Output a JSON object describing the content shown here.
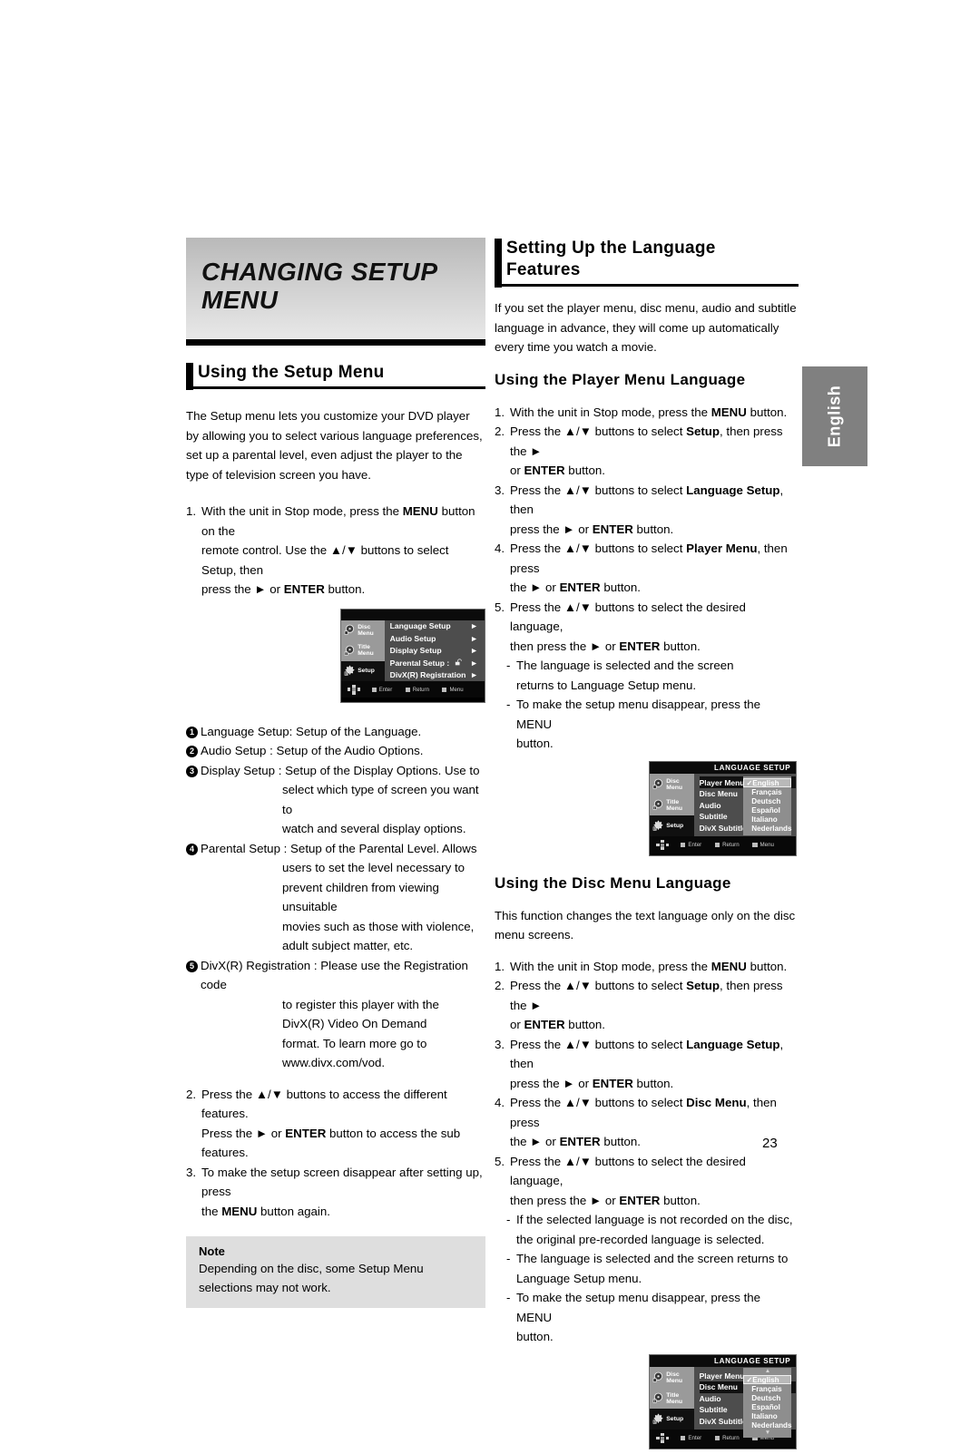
{
  "page": {
    "number": "23",
    "side_tab": "English"
  },
  "left": {
    "chapter_title": "CHANGING SETUP\nMENU",
    "section_heading": "Using the Setup Menu",
    "intro": "The Setup menu lets you customize your DVD player by allowing you to select various language preferences, set up a parental level, even adjust the player to the type of television screen you have.",
    "step1": {
      "num": "1.",
      "line1_a": "With the unit in Stop mode, press the ",
      "line1_b": "MENU",
      "line1_c": " button on the",
      "line2": "remote control.  Use the ▲/▼ buttons to select Setup, then",
      "line3_a": "press the ► or ",
      "line3_b": "ENTER",
      "line3_c": " button."
    },
    "definitions": [
      {
        "mark": "1",
        "term": "Language Setup: Setup of the Language.",
        "cont": []
      },
      {
        "mark": "2",
        "term": "Audio Setup : Setup of the Audio Options.",
        "cont": []
      },
      {
        "mark": "3",
        "term": "Display Setup : Setup of the Display Options. Use to",
        "cont": [
          "select which type of screen you want to",
          "watch and several display options."
        ]
      },
      {
        "mark": "4",
        "term": "Parental Setup : Setup of the Parental Level. Allows",
        "cont": [
          "users to set the level necessary to",
          "prevent children from viewing unsuitable",
          "movies such as those with violence,",
          "adult subject matter, etc."
        ]
      },
      {
        "mark": "5",
        "term": "DivX(R) Registration : Please use the Registration code",
        "cont": [
          "to register this player with the",
          "DivX(R) Video On Demand",
          "format. To learn more go to",
          "www.divx.com/vod."
        ]
      }
    ],
    "step2": {
      "num": "2.",
      "line1": "Press the ▲/▼ buttons to access the different  features.",
      "line2_a": "Press the ► or ",
      "line2_b": "ENTER",
      "line2_c": " button to access the sub features."
    },
    "step3": {
      "num": "3.",
      "line1": "To make the setup screen disappear after setting up, press",
      "line2_a": "the ",
      "line2_b": "MENU",
      "line2_c": " button again."
    },
    "note": {
      "title": "Note",
      "text": "Depending on the disc, some Setup Menu selections may not work."
    }
  },
  "right": {
    "section_heading": "Setting Up the Language\nFeatures",
    "intro": "If you set the player menu, disc menu, audio and subtitle language in advance, they will come up automatically every time you watch a movie.",
    "player_menu": {
      "heading": "Using the Player Menu Language",
      "steps": [
        {
          "num": "1.",
          "parts": [
            {
              "t": "With the unit in Stop mode, press the "
            },
            {
              "t": "MENU",
              "b": true
            },
            {
              "t": " button."
            }
          ]
        },
        {
          "num": "2.",
          "parts": [
            {
              "t": "Press the ▲/▼ buttons to select "
            },
            {
              "t": "Setup",
              "b": true
            },
            {
              "t": ", then press the ►"
            }
          ],
          "cont": [
            [
              {
                "t": "or "
              },
              {
                "t": "ENTER",
                "b": true
              },
              {
                "t": " button."
              }
            ]
          ]
        },
        {
          "num": "3.",
          "parts": [
            {
              "t": "Press the ▲/▼ buttons to select "
            },
            {
              "t": "Language Setup",
              "b": true
            },
            {
              "t": ", then"
            }
          ],
          "cont": [
            [
              {
                "t": "press the ► or "
              },
              {
                "t": "ENTER",
                "b": true
              },
              {
                "t": " button."
              }
            ]
          ]
        },
        {
          "num": "4.",
          "parts": [
            {
              "t": "Press the ▲/▼ buttons to select "
            },
            {
              "t": "Player Menu",
              "b": true
            },
            {
              "t": ", then press"
            }
          ],
          "cont": [
            [
              {
                "t": "the ► or "
              },
              {
                "t": "ENTER",
                "b": true
              },
              {
                "t": " button."
              }
            ]
          ]
        },
        {
          "num": "5.",
          "parts": [
            {
              "t": "Press the ▲/▼ buttons to select the desired language,"
            }
          ],
          "cont": [
            [
              {
                "t": "then press the ► or "
              },
              {
                "t": "ENTER",
                "b": true
              },
              {
                "t": " button."
              }
            ]
          ]
        }
      ],
      "dashes": [
        {
          "l1": "The language is selected and the screen",
          "l2": "returns to Language Setup menu."
        },
        {
          "l1": "To make the setup menu disappear, press the MENU",
          "l2": "button."
        }
      ]
    },
    "disc_menu": {
      "heading": "Using the Disc Menu Language",
      "intro": "This function changes the text language only on the disc menu screens.",
      "steps": [
        {
          "num": "1.",
          "parts": [
            {
              "t": "With the unit in Stop mode, press the "
            },
            {
              "t": "MENU",
              "b": true
            },
            {
              "t": " button."
            }
          ]
        },
        {
          "num": "2.",
          "parts": [
            {
              "t": "Press the ▲/▼ buttons to select "
            },
            {
              "t": "Setup",
              "b": true
            },
            {
              "t": ", then press the ►"
            }
          ],
          "cont": [
            [
              {
                "t": "or "
              },
              {
                "t": "ENTER",
                "b": true
              },
              {
                "t": " button."
              }
            ]
          ]
        },
        {
          "num": "3.",
          "parts": [
            {
              "t": "Press the ▲/▼ buttons to select "
            },
            {
              "t": "Language Setup",
              "b": true
            },
            {
              "t": ", then"
            }
          ],
          "cont": [
            [
              {
                "t": "press the ► or "
              },
              {
                "t": "ENTER",
                "b": true
              },
              {
                "t": " button."
              }
            ]
          ]
        },
        {
          "num": "4.",
          "parts": [
            {
              "t": "Press the  ▲/▼ buttons to select "
            },
            {
              "t": "Disc Menu",
              "b": true
            },
            {
              "t": ", then press"
            }
          ],
          "cont": [
            [
              {
                "t": "the ► or "
              },
              {
                "t": "ENTER",
                "b": true
              },
              {
                "t": "  button."
              }
            ]
          ]
        },
        {
          "num": "5.",
          "parts": [
            {
              "t": "Press the ▲/▼ buttons to select the desired language,"
            }
          ],
          "cont": [
            [
              {
                "t": "then press the ► or "
              },
              {
                "t": "ENTER",
                "b": true
              },
              {
                "t": " button."
              }
            ]
          ]
        }
      ],
      "dashes": [
        {
          "l1": "If the selected language is not recorded on  the disc,",
          "l2": "the original pre-recorded language is selected."
        },
        {
          "l1": "The language is selected and the screen returns to",
          "l2": "Language Setup menu."
        },
        {
          "l1": "To make the setup menu disappear, press the MENU",
          "l2": "button."
        }
      ]
    }
  },
  "osd_setup": {
    "title": "",
    "side_items": [
      {
        "label": "Disc Menu",
        "icon": "disc-menu-icon",
        "state": "light"
      },
      {
        "label": "Title Menu",
        "icon": "title-menu-icon",
        "state": "light"
      },
      {
        "label": "Setup",
        "icon": "setup-icon",
        "state": "dark"
      }
    ],
    "rows": [
      {
        "label": "Language Setup",
        "arrow": "►"
      },
      {
        "label": "Audio Setup",
        "arrow": "►"
      },
      {
        "label": "Display Setup",
        "arrow": "►"
      },
      {
        "label": "Parental Setup :",
        "arrow": "►",
        "lock": true
      },
      {
        "label": "DivX(R) Registration",
        "arrow": "►"
      }
    ],
    "bottom": [
      "Enter",
      "Return",
      "Menu"
    ]
  },
  "osd_language_player": {
    "title": "LANGUAGE SETUP",
    "side_items": [
      {
        "label": "Disc Menu",
        "icon": "disc-menu-icon",
        "state": "light"
      },
      {
        "label": "Title Menu",
        "icon": "title-menu-icon",
        "state": "light"
      },
      {
        "label": "Setup",
        "icon": "setup-icon",
        "state": "dark"
      }
    ],
    "rows": [
      {
        "label": "Player Menu",
        "selected": true
      },
      {
        "label": "Disc Menu"
      },
      {
        "label": "Audio"
      },
      {
        "label": "Subtitle"
      },
      {
        "label": "DivX Subtitle"
      }
    ],
    "languages": [
      "English",
      "Français",
      "Deutsch",
      "Español",
      "Italiano",
      "Nederlands"
    ],
    "selected_language": "English",
    "scroll_up": false,
    "scroll_down": false,
    "bottom": [
      "Enter",
      "Return",
      "Menu"
    ]
  },
  "osd_language_disc": {
    "title": "LANGUAGE SETUP",
    "side_items": [
      {
        "label": "Disc Menu",
        "icon": "disc-menu-icon",
        "state": "light"
      },
      {
        "label": "Title Menu",
        "icon": "title-menu-icon",
        "state": "light"
      },
      {
        "label": "Setup",
        "icon": "setup-icon",
        "state": "dark"
      }
    ],
    "rows": [
      {
        "label": "Player Menu"
      },
      {
        "label": "Disc Menu",
        "selected": true
      },
      {
        "label": "Audio"
      },
      {
        "label": "Subtitle"
      },
      {
        "label": "DivX Subtitle"
      }
    ],
    "languages": [
      "English",
      "Français",
      "Deutsch",
      "Español",
      "Italiano",
      "Nederlands"
    ],
    "selected_language": "English",
    "scroll_up": true,
    "scroll_down": true,
    "bottom": [
      "Enter",
      "Return",
      "Menu"
    ]
  }
}
